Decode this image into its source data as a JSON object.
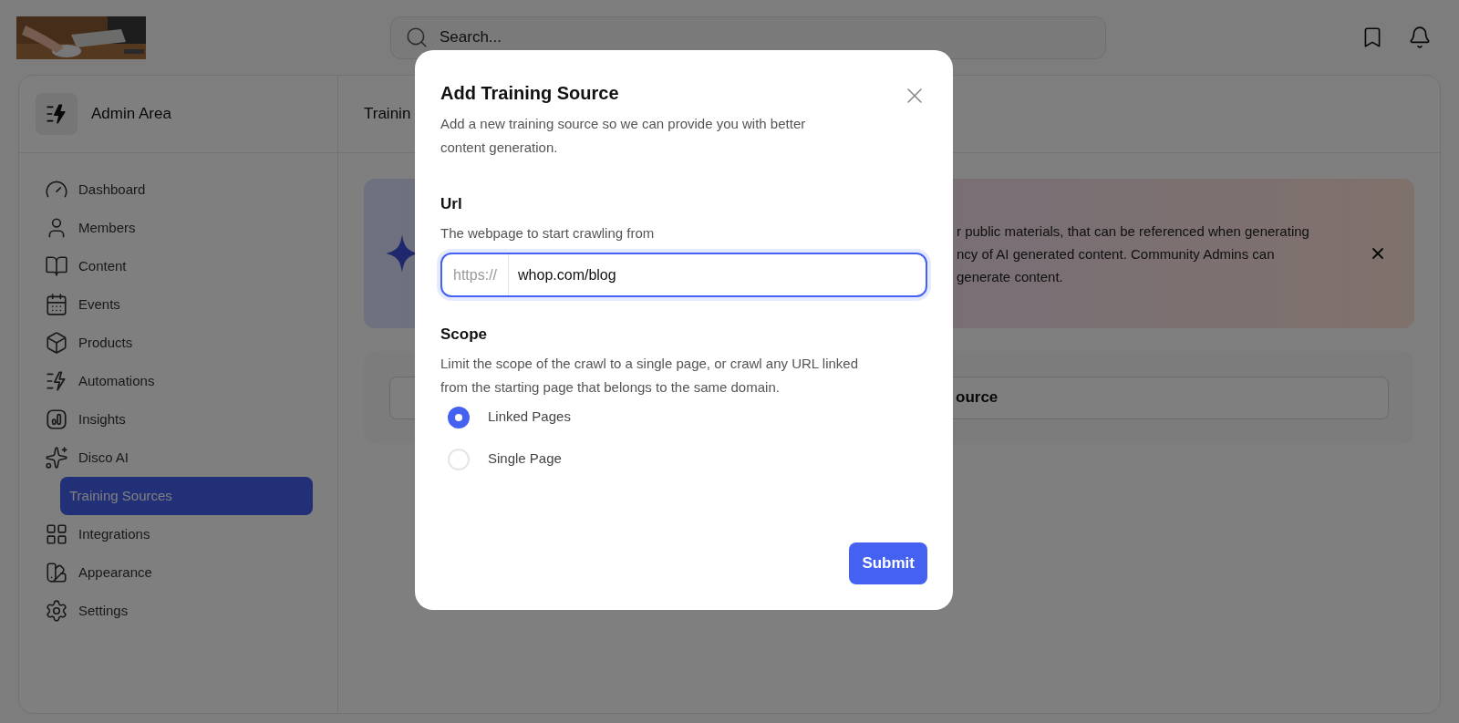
{
  "top_bar": {
    "search": {
      "placeholder": "Search..."
    }
  },
  "sidebar": {
    "title": "Admin Area",
    "items": [
      {
        "label": "Dashboard",
        "selected": false
      },
      {
        "label": "Members",
        "selected": false
      },
      {
        "label": "Content",
        "selected": false
      },
      {
        "label": "Events",
        "selected": false
      },
      {
        "label": "Products",
        "selected": false
      },
      {
        "label": "Automations",
        "selected": false
      },
      {
        "label": "Insights",
        "selected": false
      },
      {
        "label": "Disco AI",
        "selected": false,
        "children": [
          {
            "label": "Training Sources",
            "selected": true
          }
        ]
      },
      {
        "label": "Integrations",
        "selected": false
      },
      {
        "label": "Appearance",
        "selected": false
      },
      {
        "label": "Settings",
        "selected": false
      }
    ]
  },
  "main": {
    "header_title": "Trainin",
    "banner": {
      "lines": [
        "r public materials, that can be referenced when generating",
        "ncy of AI generated content. Community Admins can",
        "generate content."
      ]
    },
    "add_button": {
      "label": "ource"
    }
  },
  "modal": {
    "title": "Add Training Source",
    "description": "Add a new training source so we can provide you with better content generation.",
    "url": {
      "label": "Url",
      "hint": "The webpage to start crawling from",
      "prefix": "https://",
      "value": "whop.com/blog",
      "focused": true
    },
    "scope": {
      "label": "Scope",
      "description": "Limit the scope of the crawl to a single page, or crawl any URL linked from the starting page that belongs to the same domain.",
      "options": [
        {
          "label": "Linked Pages",
          "selected": true
        },
        {
          "label": "Single Page",
          "selected": false
        }
      ]
    },
    "submit": "Submit"
  }
}
